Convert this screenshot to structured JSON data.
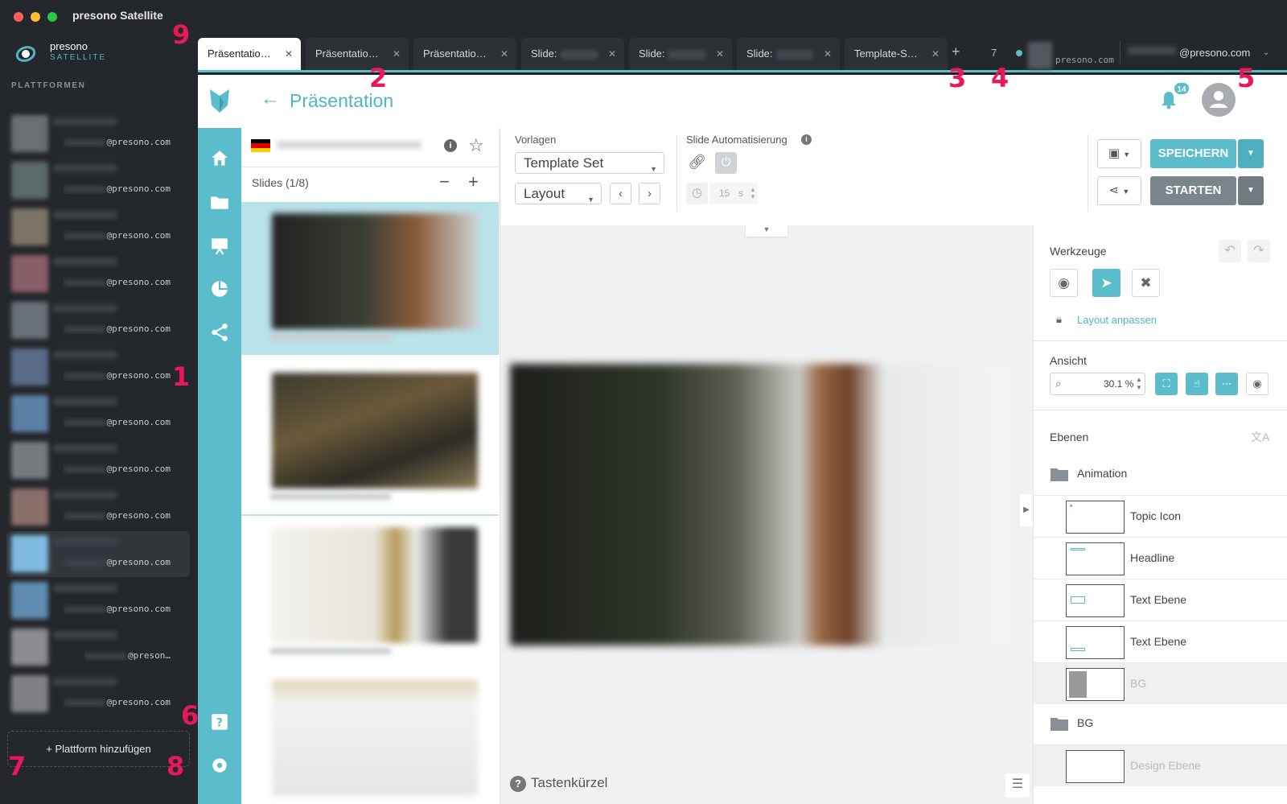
{
  "window": {
    "title": "presono Satellite"
  },
  "brand": {
    "name": "presono",
    "sub": "SATELLITE"
  },
  "sidebar": {
    "heading": "PLATTFORMEN",
    "items": [
      {
        "email": "@presono.com",
        "color": "#6b6f74"
      },
      {
        "email": "@presono.com",
        "color": "#5d6a6a"
      },
      {
        "email": "@presono.com",
        "color": "#7c7566"
      },
      {
        "email": "@presono.com",
        "color": "#8a6068"
      },
      {
        "email": "@presono.com",
        "color": "#6a7078"
      },
      {
        "email": "@presono.com",
        "color": "#5a6b88"
      },
      {
        "email": "@presono.com",
        "color": "#5c7fa6"
      },
      {
        "email": "@presono.com",
        "color": "#76797d"
      },
      {
        "email": "@presono.com",
        "color": "#8c6e6b"
      },
      {
        "email": "@presono.com",
        "color": "#7fbbe0",
        "active": true
      },
      {
        "email": "@presono.com",
        "color": "#5f8cb0"
      },
      {
        "email": "@preson…",
        "color": "#8a8c8f"
      },
      {
        "email": "@presono.com",
        "color": "#7f8185"
      }
    ],
    "add_label": "Plattform hinzufügen"
  },
  "tabs": [
    {
      "label": "Präsentatio…",
      "active": true
    },
    {
      "label": "Präsentatio…"
    },
    {
      "label": "Präsentatio…"
    },
    {
      "label": "Slide:"
    },
    {
      "label": "Slide:"
    },
    {
      "label": "Slide:"
    },
    {
      "label": "Template-S…"
    }
  ],
  "tabbar": {
    "plus": "+",
    "count": "7",
    "account_domain": "presono.com",
    "account_email": "@presono.com"
  },
  "header": {
    "title": "Präsentation",
    "notifications": "14"
  },
  "slides_panel": {
    "title": "Slides (1/8)"
  },
  "toolbar": {
    "vorlagen_label": "Vorlagen",
    "template_set": "Template Set",
    "layout": "Layout",
    "automation_label": "Slide Automatisierung",
    "seconds_value": "15",
    "seconds_unit": "s",
    "save_label": "SPEICHERN",
    "start_label": "STARTEN"
  },
  "canvas": {
    "shortcut_label": "Tastenkürzel"
  },
  "right_panel": {
    "tools_heading": "Werkzeuge",
    "layout_link": "Layout anpassen",
    "view_heading": "Ansicht",
    "zoom": "30.1 %",
    "layers_heading": "Ebenen",
    "folders": [
      {
        "name": "Animation",
        "layers": [
          "Topic Icon",
          "Headline",
          "Text Ebene",
          "Text Ebene",
          "BG"
        ]
      },
      {
        "name": "BG",
        "layers": [
          "Design Ebene"
        ]
      }
    ]
  },
  "annotations": [
    "1",
    "2",
    "3",
    "4",
    "5",
    "6",
    "7",
    "8",
    "9"
  ],
  "colors": {
    "accent": "#5bbdcc",
    "annotation": "#e8185a",
    "sidebar_bg": "#24272b"
  }
}
